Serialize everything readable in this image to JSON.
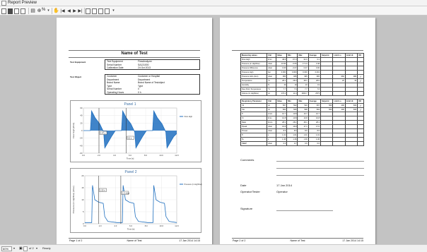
{
  "window": {
    "title": "Report Preview"
  },
  "toolbar": {
    "zoom_percent": "%"
  },
  "page1": {
    "heading": "Name of Test",
    "equipment": {
      "label": "Test Equipment",
      "rows": [
        {
          "k": "Test Equipment",
          "v": "FlowAnalyzer"
        },
        {
          "k": "Serial Number",
          "v": "SA131000"
        },
        {
          "k": "Calibration Date",
          "v": "24 Oct 2013"
        }
      ]
    },
    "object": {
      "label": "Test Object",
      "rows": [
        {
          "k": "Customer",
          "v": "Customer or Hospital"
        },
        {
          "k": "Department",
          "v": "Department"
        },
        {
          "k": "Brand Name",
          "v": "Brand Name of Testobject"
        },
        {
          "k": "Type",
          "v": "Type"
        },
        {
          "k": "Serial Number",
          "v": "0"
        },
        {
          "k": "Operating Hours",
          "v": "0 h"
        }
      ]
    },
    "panel1": {
      "title": "Panel 1",
      "ylabel": "Flow High [l/min]",
      "xlabel": "Time [s]",
      "legend": "Flow High",
      "yticks": [
        "60",
        "40",
        "20",
        "0",
        "-20",
        "-40",
        "-60"
      ],
      "xticks": [
        "0.0",
        "2.0",
        "4.0",
        "6.0",
        "8.0",
        "10.0",
        "12.0"
      ],
      "cursor_labels": [
        "1.87 s",
        "5.5 s"
      ],
      "waveform": [
        [
          0,
          0
        ],
        [
          0.9,
          0
        ],
        [
          1.05,
          52
        ],
        [
          1.5,
          34
        ],
        [
          2.1,
          18
        ],
        [
          2.6,
          -4
        ],
        [
          2.75,
          -46
        ],
        [
          3.6,
          -16
        ],
        [
          4.1,
          0
        ],
        [
          4.9,
          0
        ],
        [
          5.05,
          52
        ],
        [
          5.5,
          34
        ],
        [
          6.1,
          18
        ],
        [
          6.6,
          -4
        ],
        [
          6.75,
          -46
        ],
        [
          7.6,
          -16
        ],
        [
          8.1,
          0
        ],
        [
          8.9,
          0
        ],
        [
          9.05,
          52
        ],
        [
          9.5,
          34
        ],
        [
          10.1,
          18
        ],
        [
          10.6,
          -4
        ],
        [
          10.75,
          -46
        ],
        [
          11.6,
          -16
        ],
        [
          12,
          -8
        ]
      ],
      "xlim": [
        0,
        12
      ],
      "ylim": [
        -60,
        60
      ],
      "color": "#1f6fbf"
    },
    "panel2": {
      "title": "Panel 2",
      "ylabel": "Pressure (in Highflow) [mbar]",
      "xlabel": "Time [s]",
      "legend": "Pressure (in Highflow)",
      "yticks": [
        "20",
        "15",
        "10",
        "5",
        "0"
      ],
      "xticks": [
        "0.0",
        "2.0",
        "4.0",
        "6.0",
        "8.0",
        "10.0",
        "12.0"
      ],
      "cursor_labels": [
        "1.32 s",
        "1.6 mbar"
      ],
      "waveform": [
        [
          0,
          0.5
        ],
        [
          0.9,
          0.5
        ],
        [
          1.0,
          16
        ],
        [
          1.3,
          10
        ],
        [
          1.8,
          9
        ],
        [
          2.4,
          8.5
        ],
        [
          2.6,
          3
        ],
        [
          3.0,
          1
        ],
        [
          4.2,
          0.5
        ],
        [
          4.9,
          0.5
        ],
        [
          5.0,
          16
        ],
        [
          5.3,
          10
        ],
        [
          5.8,
          9
        ],
        [
          6.4,
          8.5
        ],
        [
          6.6,
          3
        ],
        [
          7.0,
          1
        ],
        [
          8.2,
          0.5
        ],
        [
          8.9,
          0.5
        ],
        [
          9.0,
          16
        ],
        [
          9.3,
          10
        ],
        [
          9.8,
          9
        ],
        [
          10.4,
          8.5
        ],
        [
          10.6,
          3
        ],
        [
          11.0,
          1
        ],
        [
          12,
          0.5
        ]
      ],
      "xlim": [
        0,
        12
      ],
      "ylim": [
        0,
        20
      ],
      "color": "#1f6fbf"
    },
    "footer": {
      "page": "Page 1 of 2",
      "name": "Name of Test",
      "date": "17 Jan 2014 14:15"
    }
  },
  "page2": {
    "table1": {
      "headers": [
        "Measuring values",
        "Unit",
        "Value",
        "Min",
        "Max",
        "Average",
        "Setpoint",
        "Limit Lo",
        "Limit Hi",
        "OK"
      ],
      "rows": [
        [
          "Flow High",
          "l/min",
          "48.8",
          "-57.0",
          "62.0",
          "0.1",
          "",
          "",
          "",
          ""
        ],
        [
          "Pressure (in Highflow)",
          "mbar",
          "13.96",
          "-0.06",
          "17.14",
          "3.48",
          "",
          "",
          "",
          ""
        ],
        [
          "Pressure Difference",
          "mbar",
          "0.06",
          "-0.07",
          "0.07",
          "0.00",
          "",
          "",
          "",
          ""
        ],
        [
          "Pressure High",
          "bar",
          "0.000",
          "0.000",
          "0.000",
          "0.001",
          "",
          "",
          "",
          ""
        ],
        [
          "Pressure Hi/lo (Atm)",
          "mbar",
          "965",
          "965",
          "965",
          "965",
          "",
          "960",
          "980",
          "✓"
        ],
        [
          "Temperature",
          "°C",
          "28.1",
          "28.0",
          "28.1",
          "28.0",
          "",
          "20",
          "30",
          "✓"
        ],
        [
          "Humidity",
          "%",
          "19",
          "19",
          "19",
          "19",
          "",
          "",
          "",
          ""
        ],
        [
          "Dew Point Temperature",
          "°C",
          "7.7",
          "7.6",
          "7.7",
          "7.6",
          "",
          "",
          "",
          ""
        ],
        [
          "Volume (in Highflow)",
          "ml",
          "176.2",
          "11.4",
          "3000.7",
          "2573",
          "",
          "",
          "",
          ""
        ]
      ]
    },
    "table2": {
      "headers": [
        "Respiratory Parameter",
        "Unit",
        "Value",
        "Min",
        "Max",
        "Average",
        "Setpoint",
        "Limit Lo",
        "Limit Hi",
        "OK"
      ],
      "rows": [
        [
          "Vti",
          "ml",
          "507",
          "502",
          "510",
          "507",
          "500",
          "400",
          "600",
          "✓"
        ],
        [
          "Vte",
          "ml",
          "500",
          "506",
          "508",
          "504",
          "500",
          "400",
          "600",
          "✓"
        ],
        [
          "Ti",
          "s/min",
          "10.7",
          "10.8",
          "10.7",
          "10.7",
          "",
          "",
          "",
          ""
        ],
        [
          "Vt",
          "l/min",
          "10.8",
          "10.8",
          "10.8",
          "10.8",
          "",
          "",
          "",
          ""
        ],
        [
          "Ratio",
          "b/min",
          "28.1",
          "28.1",
          "28.1",
          "28.1",
          "",
          "",
          "",
          ""
        ],
        [
          "Ppeak",
          "mbar",
          "16.8",
          "16.8",
          "17.1",
          "17.0",
          "",
          "",
          "",
          ""
        ],
        [
          "Pmean",
          "mbar",
          "8.6",
          "8.6",
          "8.6",
          "8.6",
          "",
          "",
          "",
          ""
        ],
        [
          "Ti",
          "s",
          "1.01",
          "1.01",
          "1.01",
          "1.01",
          "",
          "",
          "",
          ""
        ],
        [
          "Te",
          "s",
          "1.36",
          "1.36",
          "1.36",
          "1.36",
          "",
          "",
          "",
          ""
        ],
        [
          "PEEP",
          "mbar",
          "0.6",
          "0.7",
          "0.6",
          "0.6",
          "",
          "",
          "",
          ""
        ]
      ]
    },
    "comments_label": "Comments",
    "date_label": "Date",
    "date_value": "17 Jan 2014",
    "operator_label": "Operator/Tester",
    "operator_value": "Operator",
    "signature_label": "Signature",
    "footer": {
      "page": "Page 2 of 2",
      "name": "Name of Test",
      "date": "17 Jan 2014 14:15"
    }
  },
  "statusbar": {
    "zoom": "60%",
    "page_of": "of 2",
    "ready": "Ready"
  }
}
